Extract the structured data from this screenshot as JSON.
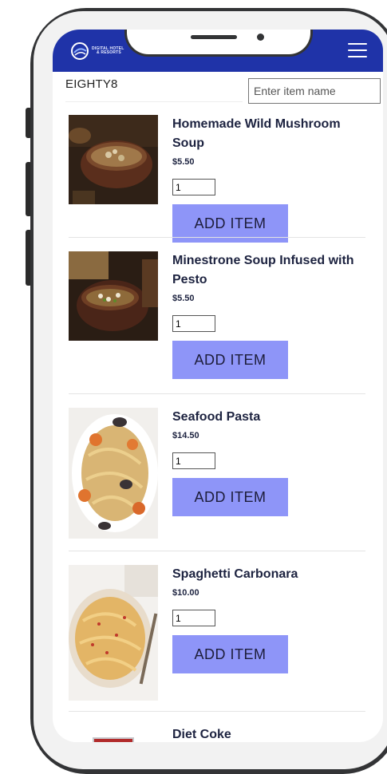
{
  "brand": {
    "logo_text_line1": "DIGITAL HOTEL",
    "logo_text_line2": "& RESORTS",
    "accent": "#1f33a8",
    "button_color": "#8e95f8"
  },
  "header": {
    "restaurant_name": "EIGHTY8",
    "search_placeholder": "Enter item name",
    "menu_icon": "hamburger-menu-icon"
  },
  "items": [
    {
      "name": "Homemade Wild Mushroom Soup",
      "price": "$5.50",
      "qty": "1",
      "button": "ADD ITEM"
    },
    {
      "name": "Minestrone Soup Infused with Pesto",
      "price": "$5.50",
      "qty": "1",
      "button": "ADD ITEM"
    },
    {
      "name": "Seafood Pasta",
      "price": "$14.50",
      "qty": "1",
      "button": "ADD ITEM"
    },
    {
      "name": "Spaghetti Carbonara",
      "price": "$10.00",
      "qty": "1",
      "button": "ADD ITEM"
    },
    {
      "name": "Diet Coke"
    }
  ]
}
